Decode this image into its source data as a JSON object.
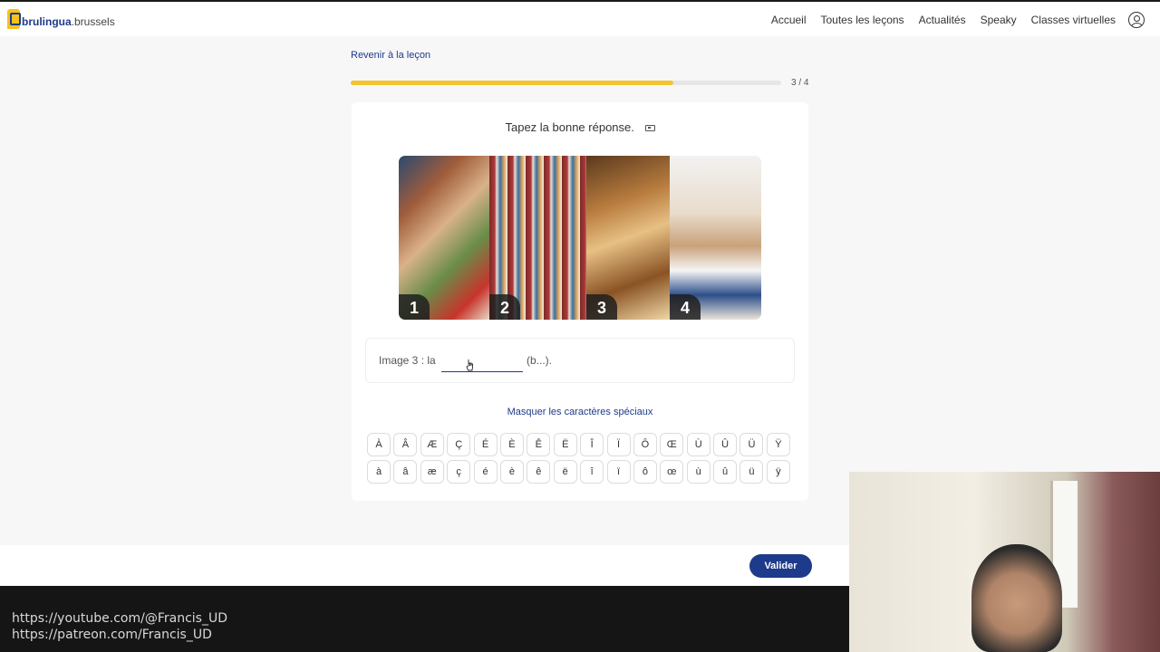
{
  "header": {
    "logo_text": "brulingua",
    "logo_suffix": ".brussels",
    "nav": [
      "Accueil",
      "Toutes les leçons",
      "Actualités",
      "Speaky",
      "Classes virtuelles"
    ]
  },
  "lesson": {
    "back_label": "Revenir à la leçon",
    "progress_text": "3 / 4",
    "progress_fraction": 0.75
  },
  "exercise": {
    "instruction": "Tapez la bonne réponse.",
    "image_badges": [
      "1",
      "2",
      "3",
      "4"
    ],
    "prefix": "Image 3 : la",
    "answer_value": "",
    "hint": "(b...).",
    "toggle_special_label": "Masquer les caractères spéciaux",
    "keys_upper": [
      "À",
      "Â",
      "Æ",
      "Ç",
      "É",
      "È",
      "Ê",
      "Ë",
      "Î",
      "Ï",
      "Ô",
      "Œ",
      "Ù",
      "Û",
      "Ü",
      "Ÿ"
    ],
    "keys_lower": [
      "à",
      "â",
      "æ",
      "ç",
      "é",
      "è",
      "ê",
      "ë",
      "î",
      "ï",
      "ô",
      "œ",
      "ù",
      "û",
      "ü",
      "ÿ"
    ]
  },
  "footer": {
    "validate_label": "Valider"
  },
  "overlay": {
    "link1": "https://youtube.com/@Francis_UD",
    "link2": "https://patreon.com/Francis_UD"
  },
  "colors": {
    "brand_blue": "#1e3a8a",
    "progress_yellow": "#f4c430"
  }
}
